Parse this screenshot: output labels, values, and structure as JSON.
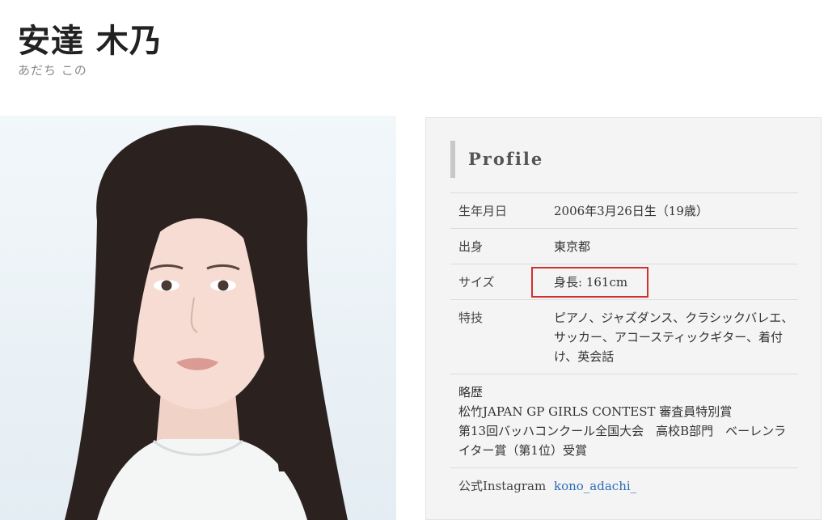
{
  "header": {
    "name": "安達 木乃",
    "reading": "あだち この"
  },
  "photo": {
    "alt": "安達 木乃"
  },
  "profile": {
    "heading": "Profile",
    "birthday_label": "生年月日",
    "birthday_value": "2006年3月26日生（19歳）",
    "hometown_label": "出身",
    "hometown_value": "東京都",
    "size_label": "サイズ",
    "size_value": "身長: 161cm",
    "skills_label": "特技",
    "skills_value": "ピアノ、ジャズダンス、クラシックバレエ、サッカー、アコースティックギター、着付け、英会話",
    "history_label": "略歴",
    "history_lines": [
      "松竹JAPAN GP GIRLS CONTEST 審査員特別賞",
      "第13回バッハコンクール全国大会　高校B部門　ベーレンライター賞（第1位）受賞"
    ],
    "instagram_label": "公式Instagram",
    "instagram_handle": "kono_adachi_"
  },
  "colors": {
    "highlight_box": "#d0312d",
    "link": "#2a6db5",
    "card_bg": "#f4f4f4"
  }
}
